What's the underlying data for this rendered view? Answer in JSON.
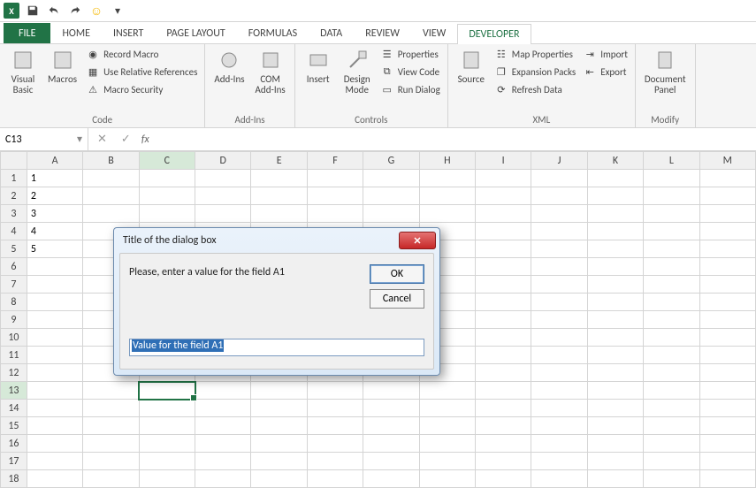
{
  "tabs": {
    "file": "FILE",
    "home": "HOME",
    "insert": "INSERT",
    "page_layout": "PAGE LAYOUT",
    "formulas": "FORMULAS",
    "data": "DATA",
    "review": "REVIEW",
    "view": "VIEW",
    "developer": "DEVELOPER"
  },
  "ribbon": {
    "code": {
      "visual_basic": "Visual\nBasic",
      "macros": "Macros",
      "record_macro": "Record Macro",
      "use_relative": "Use Relative References",
      "macro_security": "Macro Security",
      "group": "Code"
    },
    "addins": {
      "addins": "Add-Ins",
      "com_addins": "COM\nAdd-Ins",
      "group": "Add-Ins"
    },
    "controls": {
      "insert": "Insert",
      "design_mode": "Design\nMode",
      "properties": "Properties",
      "view_code": "View Code",
      "run_dialog": "Run Dialog",
      "group": "Controls"
    },
    "xml": {
      "source": "Source",
      "map_props": "Map Properties",
      "expansion": "Expansion Packs",
      "refresh": "Refresh Data",
      "import": "Import",
      "export": "Export",
      "group": "XML"
    },
    "modify": {
      "doc_panel": "Document\nPanel",
      "group": "Modify"
    }
  },
  "namebox": "C13",
  "fx_label": "fx",
  "columns": [
    "A",
    "B",
    "C",
    "D",
    "E",
    "F",
    "G",
    "H",
    "I",
    "J",
    "K",
    "L",
    "M"
  ],
  "rows": [
    1,
    2,
    3,
    4,
    5,
    6,
    7,
    8,
    9,
    10,
    11,
    12,
    13,
    14,
    15,
    16,
    17,
    18
  ],
  "cell_values": {
    "A1": "1",
    "A2": "2",
    "A3": "3",
    "A4": "4",
    "A5": "5"
  },
  "selected_cell": "C13",
  "dialog": {
    "title": "Title of the dialog box",
    "message": "Please, enter a value for the field A1",
    "ok": "OK",
    "cancel": "Cancel",
    "input_value": "Value for the field A1"
  }
}
